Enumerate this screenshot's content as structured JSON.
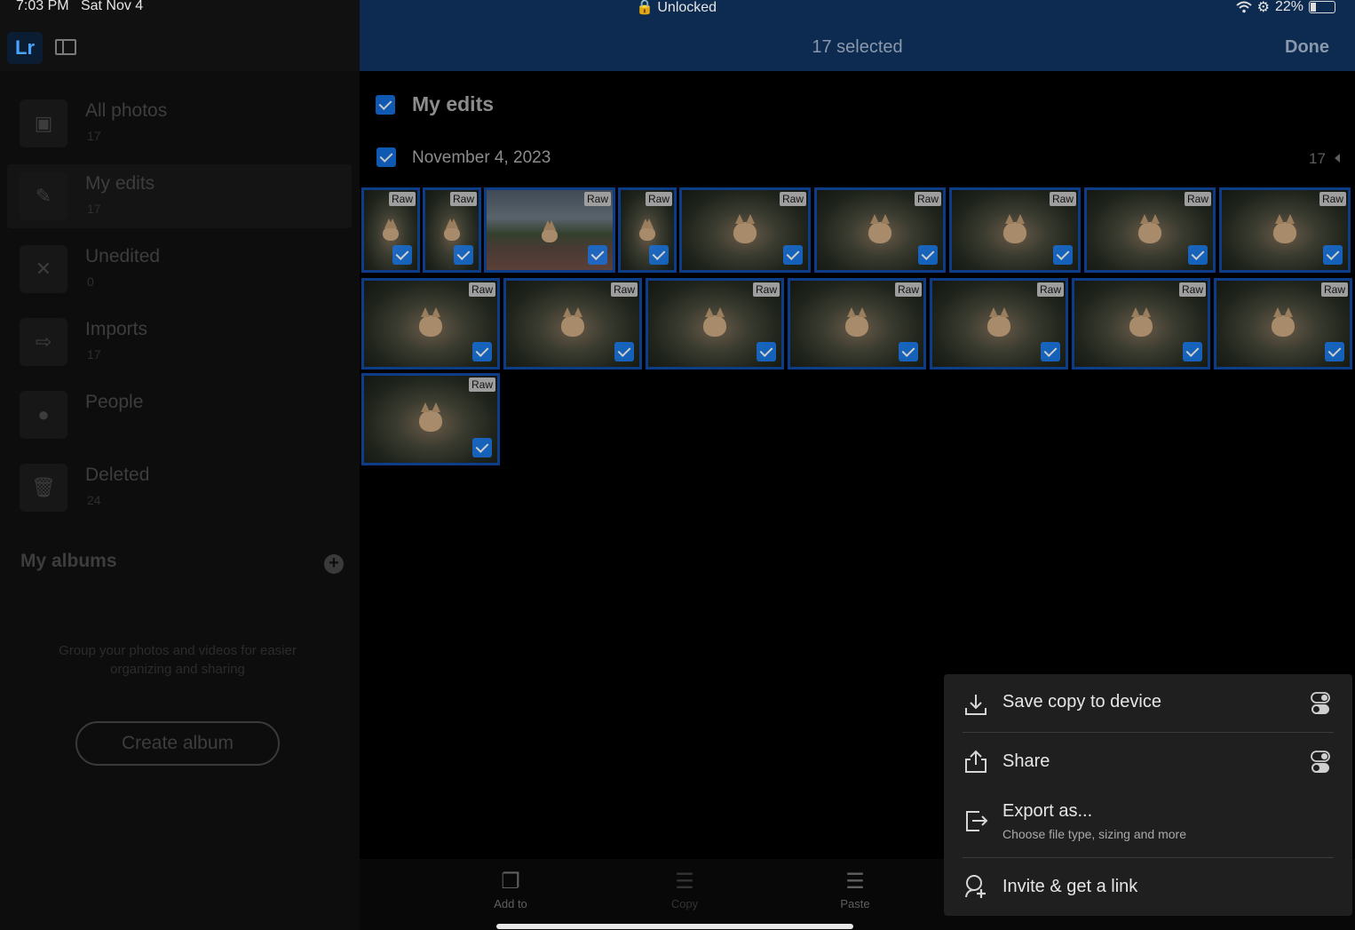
{
  "status_bar": {
    "time": "7:03 PM",
    "date": "Sat Nov 4",
    "lock_text": "Unlocked",
    "battery": "22%",
    "icons": [
      "lock-icon",
      "wifi-icon",
      "rotation-lock-icon",
      "battery-icon"
    ]
  },
  "sidebar": {
    "logo": "Lr",
    "items": [
      {
        "label": "All photos",
        "count": "17",
        "icon": "photo-icon"
      },
      {
        "label": "My edits",
        "count": "17",
        "icon": "pencil-icon"
      },
      {
        "label": "Unedited",
        "count": "0",
        "icon": "unedited-icon"
      },
      {
        "label": "Imports",
        "count": "17",
        "icon": "import-icon"
      },
      {
        "label": "People",
        "count": "",
        "icon": "person-icon"
      },
      {
        "label": "Deleted",
        "count": "24",
        "icon": "trash-icon"
      }
    ],
    "albums_title": "My albums",
    "albums_hint": "Group your photos and videos for easier organizing and sharing",
    "create_album_label": "Create album"
  },
  "header": {
    "selected_text": "17 selected",
    "done_label": "Done"
  },
  "section": {
    "title": "My edits",
    "date_label": "November 4, 2023",
    "date_count": "17"
  },
  "photos": {
    "badge": "Raw",
    "count": 17,
    "all_selected": true
  },
  "bottom_toolbar": [
    {
      "label": "Add to",
      "icon": "add-to-album-icon"
    },
    {
      "label": "Copy",
      "icon": "copy-settings-icon"
    },
    {
      "label": "Paste",
      "icon": "paste-settings-icon"
    }
  ],
  "share_menu": {
    "items": [
      {
        "label": "Save copy to device",
        "icon": "download-icon",
        "has_toggle": true
      },
      {
        "label": "Share",
        "icon": "share-icon",
        "has_toggle": true
      },
      {
        "label": "Export as...",
        "sublabel": "Choose file type, sizing and more",
        "icon": "export-icon"
      },
      {
        "label": "Invite & get a link",
        "icon": "invite-icon"
      }
    ]
  },
  "colors": {
    "accent": "#1473e6",
    "header_bg": "#0d2a50",
    "selection_border": "#0c3d86",
    "popover_bg": "#1f1f1f"
  }
}
